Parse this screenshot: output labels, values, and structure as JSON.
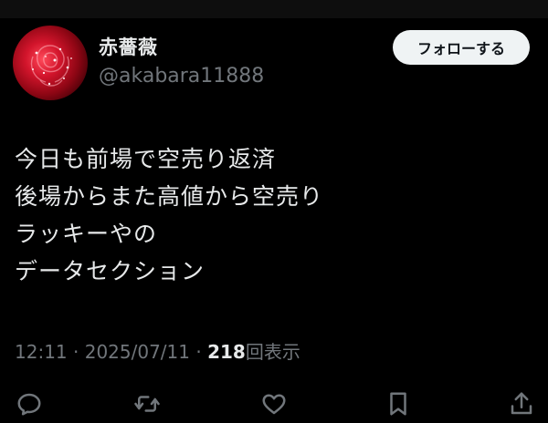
{
  "profile": {
    "display_name": "赤薔薇",
    "handle": "@akabara11888",
    "avatar_icon": "red-rose"
  },
  "follow_button": {
    "label": "フォローする"
  },
  "tweet": {
    "lines": [
      "今日も前場で空売り返済",
      "後場からまた高値から空売り",
      "ラッキーやの",
      "データセクション"
    ]
  },
  "meta": {
    "time": "12:11",
    "separator": " · ",
    "date": "2025/07/11",
    "views": "218",
    "views_label": "回表示"
  },
  "actions": [
    {
      "icon": "reply-icon"
    },
    {
      "icon": "retweet-icon"
    },
    {
      "icon": "like-icon"
    },
    {
      "icon": "bookmark-icon"
    },
    {
      "icon": "share-icon"
    }
  ],
  "colors": {
    "background": "#000000",
    "text": "#e7e9ea",
    "secondary": "#71767b",
    "button_bg": "#eff3f4"
  }
}
